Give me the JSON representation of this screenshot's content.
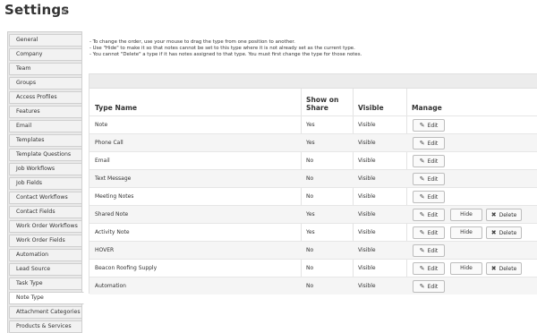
{
  "header": {
    "title": "Settings",
    "collapse_icon": "«"
  },
  "sidebar": {
    "items": [
      "General",
      "Company",
      "Team",
      "Groups",
      "Access Profiles",
      "Features",
      "Email",
      "Templates",
      "Template Questions",
      "Job Workflows",
      "Job Fields",
      "Contact Workflows",
      "Contact Fields",
      "Work Order Workflows",
      "Work Order Fields",
      "Automation",
      "Lead Source",
      "Task Type",
      "Note Type",
      "Attachment Categories",
      "Products & Services"
    ],
    "active": "Note Type"
  },
  "instructions": [
    "- To change the order, use your mouse to drag the type from one position to another.",
    "- Use \"Hide\" to make it so that notes cannot be set to this type where it is not already set as the current type.",
    "- You cannot \"Delete\" a type if it has notes assigned to that type. You must first change the type for those notes."
  ],
  "table": {
    "headers": {
      "type_name": "Type Name",
      "show_on_share_1": "Show on",
      "show_on_share_2": "Share",
      "visible": "Visible",
      "manage": "Manage"
    },
    "buttons": {
      "edit": "Edit",
      "hide": "Hide",
      "delete": "Delete"
    },
    "icons": {
      "edit": "pencil-icon",
      "delete": "trash-icon"
    },
    "rows": [
      {
        "name": "Note",
        "share": "Yes",
        "visible": "Visible",
        "hide": false,
        "delete": false
      },
      {
        "name": "Phone Call",
        "share": "Yes",
        "visible": "Visible",
        "hide": false,
        "delete": false
      },
      {
        "name": "Email",
        "share": "No",
        "visible": "Visible",
        "hide": false,
        "delete": false
      },
      {
        "name": "Text Message",
        "share": "No",
        "visible": "Visible",
        "hide": false,
        "delete": false
      },
      {
        "name": "Meeting Notes",
        "share": "No",
        "visible": "Visible",
        "hide": false,
        "delete": false
      },
      {
        "name": "Shared Note",
        "share": "Yes",
        "visible": "Visible",
        "hide": true,
        "delete": true
      },
      {
        "name": "Activity Note",
        "share": "Yes",
        "visible": "Visible",
        "hide": true,
        "delete": true
      },
      {
        "name": "HOVER",
        "share": "No",
        "visible": "Visible",
        "hide": false,
        "delete": false
      },
      {
        "name": "Beacon Roofing Supply",
        "share": "No",
        "visible": "Visible",
        "hide": true,
        "delete": true
      },
      {
        "name": "Automation",
        "share": "No",
        "visible": "Visible",
        "hide": false,
        "delete": false
      }
    ]
  }
}
